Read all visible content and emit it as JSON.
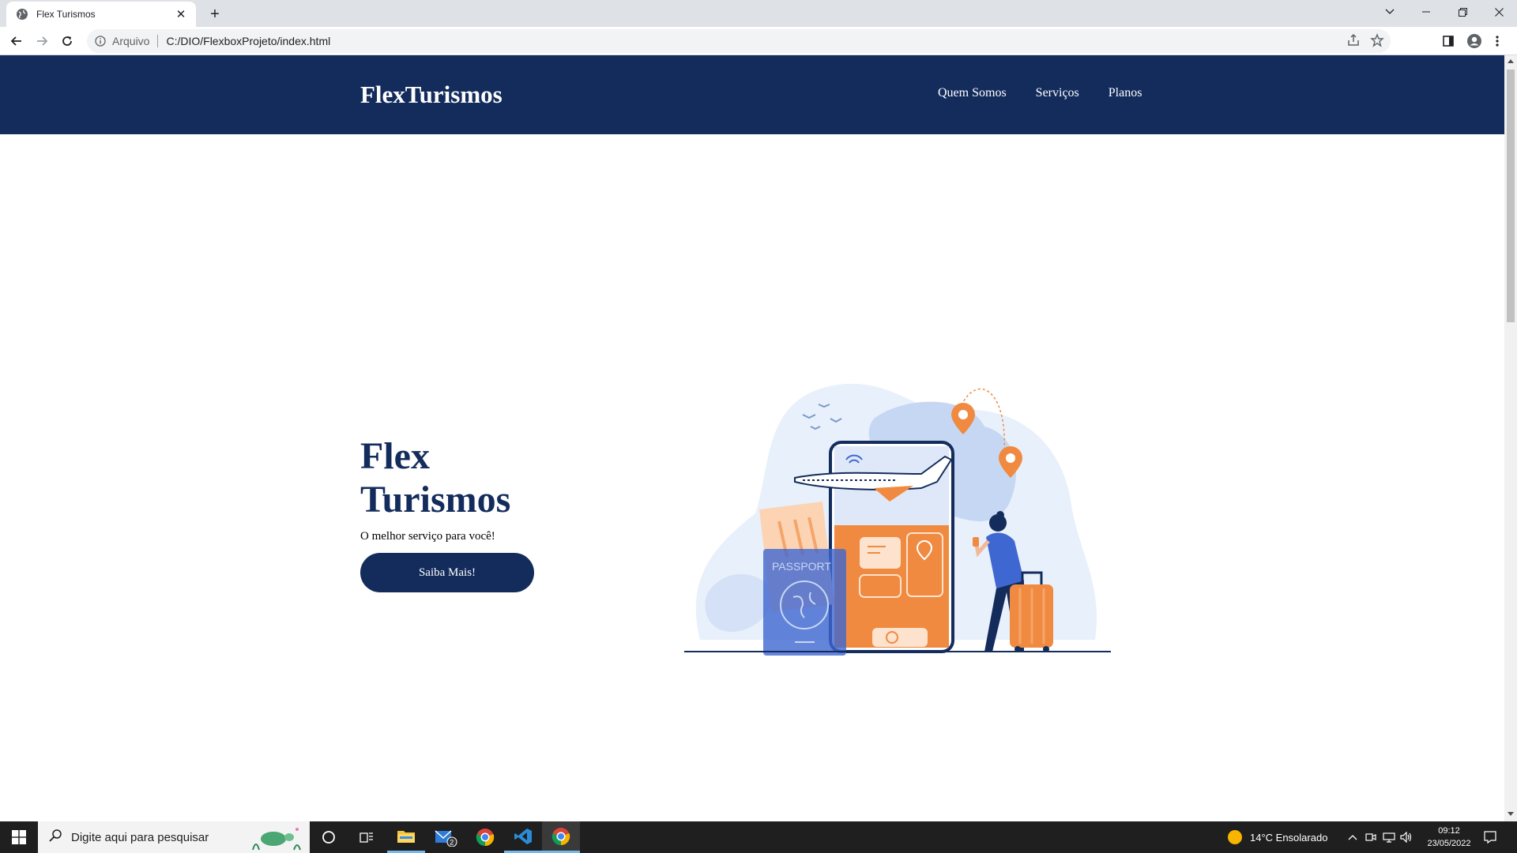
{
  "browser": {
    "tab_title": "Flex Turismos",
    "omnibox_label": "Arquivo",
    "url": "C:/DIO/FlexboxProjeto/index.html"
  },
  "site": {
    "logo": "FlexTurismos",
    "nav": [
      "Quem Somos",
      "Serviços",
      "Planos"
    ],
    "hero_title": "Flex Turismos",
    "hero_subtitle": "O melhor serviço para você!",
    "hero_button": "Saiba Mais!",
    "illustration_passport_text": "PASSPORT"
  },
  "taskbar": {
    "search_placeholder": "Digite aqui para pesquisar",
    "mail_badge": "2",
    "weather": "14°C  Ensolarado",
    "time": "09:12",
    "date": "23/05/2022"
  },
  "colors": {
    "header_bg": "#132c5c",
    "title_color": "#132c5c",
    "illustration_orange": "#f08a40",
    "illustration_blue": "#3f67d1"
  }
}
